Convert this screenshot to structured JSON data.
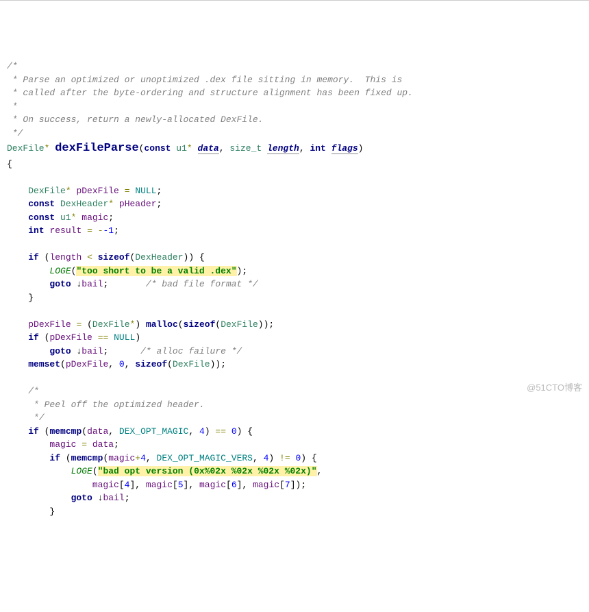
{
  "comment": {
    "l1": "/*",
    "l2": " * Parse an optimized or unoptimized .dex file sitting in memory.  This is",
    "l3": " * called after the byte-ordering and structure alignment has been fixed up.",
    "l4": " *",
    "l5": " * On success, return a newly-allocated DexFile.",
    "l6": " */"
  },
  "sig": {
    "ret": "DexFile",
    "star": "*",
    "name": "dexFileParse",
    "lp": "(",
    "const1": "const",
    "u1": "u1",
    "star2": "*",
    "data": "data",
    "comma1": ",",
    "sizet": "size_t",
    "length": "length",
    "comma2": ",",
    "int": "int",
    "flags": "flags",
    "rp": ")"
  },
  "br": {
    "open": "{",
    "close": "}"
  },
  "d1": {
    "ty": "DexFile",
    "st": "*",
    "nm": "pDexFile",
    "eq": "=",
    "null": "NULL",
    "sc": ";"
  },
  "d2": {
    "const": "const",
    "ty": "DexHeader",
    "st": "*",
    "nm": "pHeader",
    "sc": ";"
  },
  "d3": {
    "const": "const",
    "ty": "u1",
    "st": "*",
    "nm": "magic",
    "sc": ";"
  },
  "d4": {
    "ty": "int",
    "nm": "result",
    "eq": "=",
    "val": "-1",
    "sc": ";"
  },
  "if1": {
    "if": "if",
    "lp": "(",
    "a": "length",
    "lt": "<",
    "sz": "sizeof",
    "lp2": "(",
    "ty": "DexHeader",
    "rp2": ")",
    "rp": ")",
    "br": "{"
  },
  "loge1": {
    "fn": "LOGE",
    "lp": "(",
    "s": "\"too short to be a valid .dex\"",
    "rp": ")",
    "sc": ";"
  },
  "goto1": {
    "kw": "goto",
    "arr": "↓",
    "lbl": "bail",
    "sc": ";",
    "cm": "/* bad file format */"
  },
  "m1": {
    "a": "pDexFile",
    "eq": "=",
    "lp": "(",
    "ty": "DexFile",
    "st": "*",
    "rp": ")",
    "fn": "malloc",
    "lp2": "(",
    "sz": "sizeof",
    "lp3": "(",
    "ty2": "DexFile",
    "rp3": ")",
    "rp2": ")",
    "sc": ";"
  },
  "if2": {
    "if": "if",
    "lp": "(",
    "a": "pDexFile",
    "eq": "==",
    "null": "NULL",
    "rp": ")"
  },
  "goto2": {
    "kw": "goto",
    "arr": "↓",
    "lbl": "bail",
    "sc": ";",
    "cm": "/* alloc failure */"
  },
  "ms": {
    "fn": "memset",
    "lp": "(",
    "a": "pDexFile",
    "c1": ",",
    "z": "0",
    "c2": ",",
    "sz": "sizeof",
    "lp2": "(",
    "ty": "DexFile",
    "rp2": ")",
    "rp": ")",
    "sc": ";"
  },
  "c2": {
    "l1": "/*",
    "l2": " * Peel off the optimized header.",
    "l3": " */"
  },
  "if3": {
    "if": "if",
    "lp": "(",
    "fn": "memcmp",
    "lp2": "(",
    "a": "data",
    "c1": ",",
    "m": "DEX_OPT_MAGIC",
    "c2": ",",
    "n": "4",
    "rp2": ")",
    "eq": "==",
    "z": "0",
    "rp": ")",
    "br": "{"
  },
  "asg": {
    "a": "magic",
    "eq": "=",
    "b": "data",
    "sc": ";"
  },
  "if4": {
    "if": "if",
    "lp": "(",
    "fn": "memcmp",
    "lp2": "(",
    "a": "magic",
    "plus": "+",
    "n1": "4",
    "c1": ",",
    "m": "DEX_OPT_MAGIC_VERS",
    "c2": ",",
    "n2": "4",
    "rp2": ")",
    "ne": "!=",
    "z": "0",
    "rp": ")",
    "br": "{"
  },
  "loge2": {
    "fn": "LOGE",
    "lp": "(",
    "s": "\"bad opt version (0x%02x %02x %02x %02x)\"",
    "c": ","
  },
  "loge2b": {
    "a": "magic",
    "lb": "[",
    "n4": "4",
    "rb": "]",
    "c1": ",",
    "n5": "5",
    "c2": ",",
    "n6": "6",
    "c3": ",",
    "n7": "7",
    "rp": ")",
    "sc": ";"
  },
  "goto3": {
    "kw": "goto",
    "arr": "↓",
    "lbl": "bail",
    "sc": ";"
  },
  "watermark": "@51CTO博客"
}
